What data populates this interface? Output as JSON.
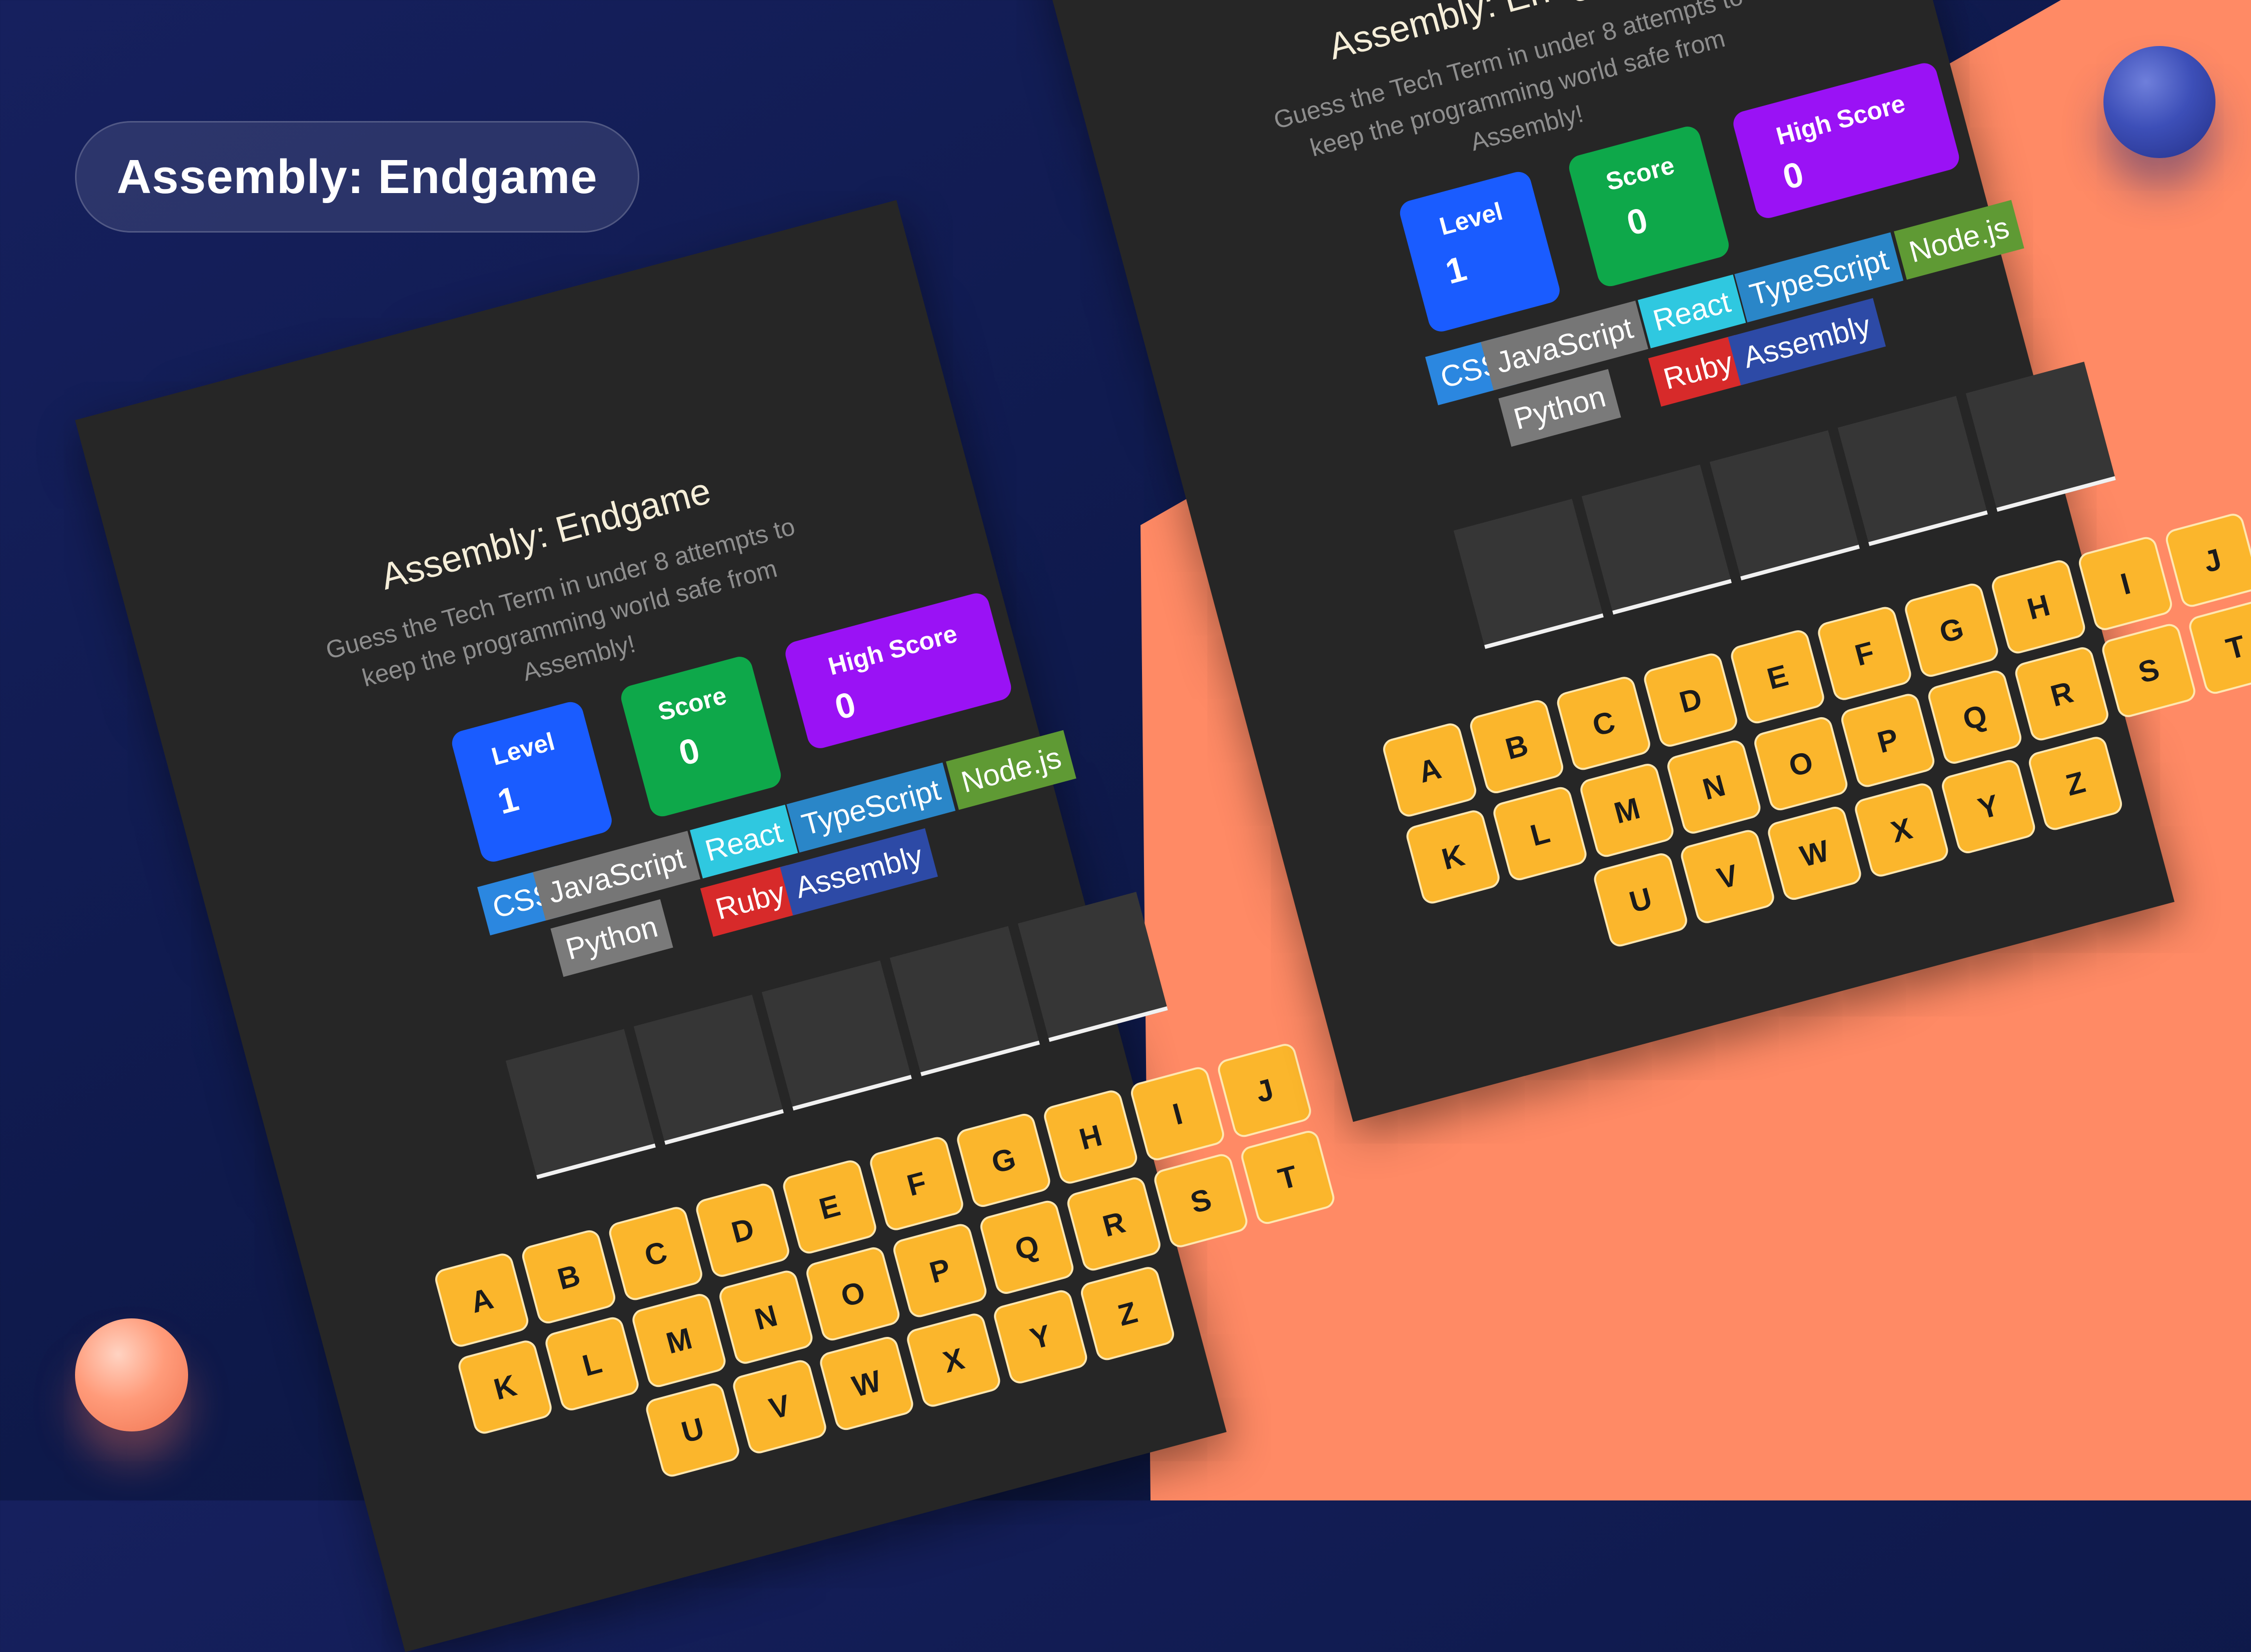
{
  "banner": {
    "title": "Assembly: Endgame"
  },
  "game": {
    "title": "Assembly: Endgame",
    "subtitle": "Guess the Tech Term in under 8 attempts to keep the programming world safe from Assembly!",
    "stats": {
      "level_label": "Level",
      "level_value": "1",
      "score_label": "Score",
      "score_value": "0",
      "high_label": "High Score",
      "high_value": "0"
    },
    "languages": [
      {
        "name": "CSS",
        "color": "#2b87e0"
      },
      {
        "name": "JavaScript",
        "color": "#767676"
      },
      {
        "name": "React",
        "color": "#2fc8e0"
      },
      {
        "name": "TypeScript",
        "color": "#2a86c8"
      },
      {
        "name": "Node.js",
        "color": "#5f9a34"
      },
      {
        "name": "Python",
        "color": "#7a7a7a"
      },
      {
        "name": "Ruby",
        "color": "#d72a2a"
      },
      {
        "name": "Assembly",
        "color": "#2d4aa6"
      }
    ],
    "slots": 5,
    "keyboard_rows": [
      [
        "A",
        "B",
        "C",
        "D",
        "E",
        "F",
        "G",
        "H",
        "I",
        "J"
      ],
      [
        "K",
        "L",
        "M",
        "N",
        "O",
        "P",
        "Q",
        "R",
        "S",
        "T"
      ],
      [
        "U",
        "V",
        "W",
        "X",
        "Y",
        "Z"
      ]
    ]
  }
}
